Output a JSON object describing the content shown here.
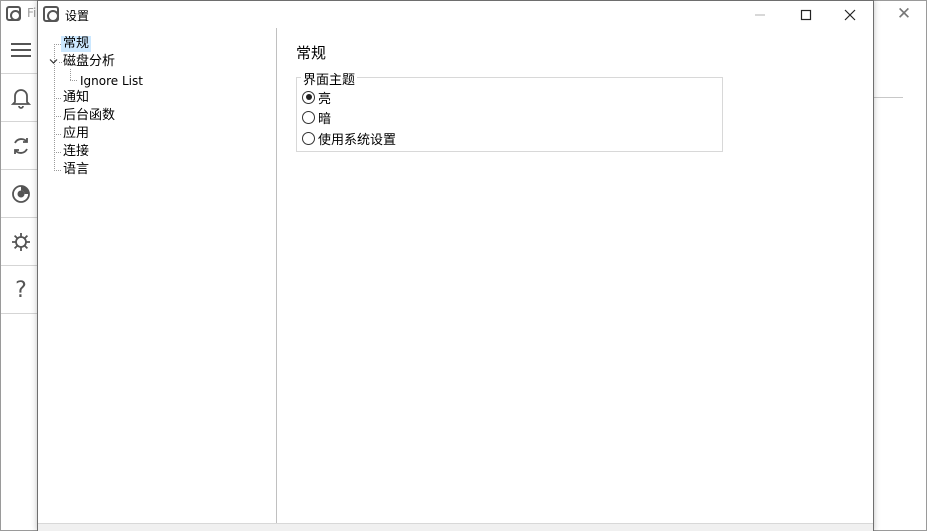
{
  "background_app": {
    "title_partial": "Fi",
    "close_glyph": "✕",
    "sidebar_icons": [
      "menu-icon",
      "bell-icon",
      "sync-icon",
      "disk-icon",
      "gear-icon",
      "help-icon"
    ],
    "help_glyph": "?"
  },
  "dialog": {
    "title": "设置",
    "buttons": {
      "minimize": "minimize",
      "maximize": "maximize",
      "close": "close"
    }
  },
  "tree": {
    "items": [
      {
        "label": "常规",
        "selected": true
      },
      {
        "label": "磁盘分析",
        "expanded": true,
        "children": [
          {
            "label": "Ignore List"
          }
        ]
      },
      {
        "label": "通知"
      },
      {
        "label": "后台函数"
      },
      {
        "label": "应用"
      },
      {
        "label": "连接"
      },
      {
        "label": "语言"
      }
    ]
  },
  "content": {
    "title": "常规",
    "theme_group": {
      "legend": "界面主题",
      "options": [
        {
          "label": "亮",
          "checked": true
        },
        {
          "label": "暗",
          "checked": false
        },
        {
          "label": "使用系统设置",
          "checked": false
        }
      ]
    }
  },
  "colors": {
    "selection": "#cce8ff",
    "border": "#d8d8d8"
  }
}
